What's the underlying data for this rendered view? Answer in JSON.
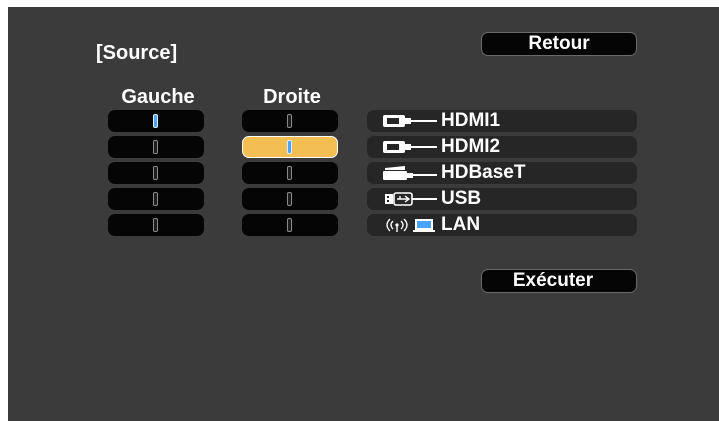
{
  "header": {
    "title": "[Source]",
    "back_label": "Retour"
  },
  "columns": {
    "left_label": "Gauche",
    "right_label": "Droite"
  },
  "left_slots": [
    {
      "active": true
    },
    {
      "active": false
    },
    {
      "active": false
    },
    {
      "active": false
    },
    {
      "active": false
    }
  ],
  "right_slots": [
    {
      "active": false,
      "selected": false
    },
    {
      "active": true,
      "selected": true
    },
    {
      "active": false,
      "selected": false
    },
    {
      "active": false,
      "selected": false
    },
    {
      "active": false,
      "selected": false
    }
  ],
  "sources": [
    {
      "label": "HDMI1",
      "icon": "hdmi-icon"
    },
    {
      "label": "HDMI2",
      "icon": "hdmi-icon"
    },
    {
      "label": "HDBaseT",
      "icon": "hdbaset-icon"
    },
    {
      "label": "USB",
      "icon": "usb-icon"
    },
    {
      "label": "LAN",
      "icon": "lan-icon"
    }
  ],
  "footer": {
    "execute_label": "Exécuter"
  },
  "colors": {
    "selected": "#f3be52",
    "active_marker": "#4aa3ff",
    "background": "#3b3b3b"
  }
}
